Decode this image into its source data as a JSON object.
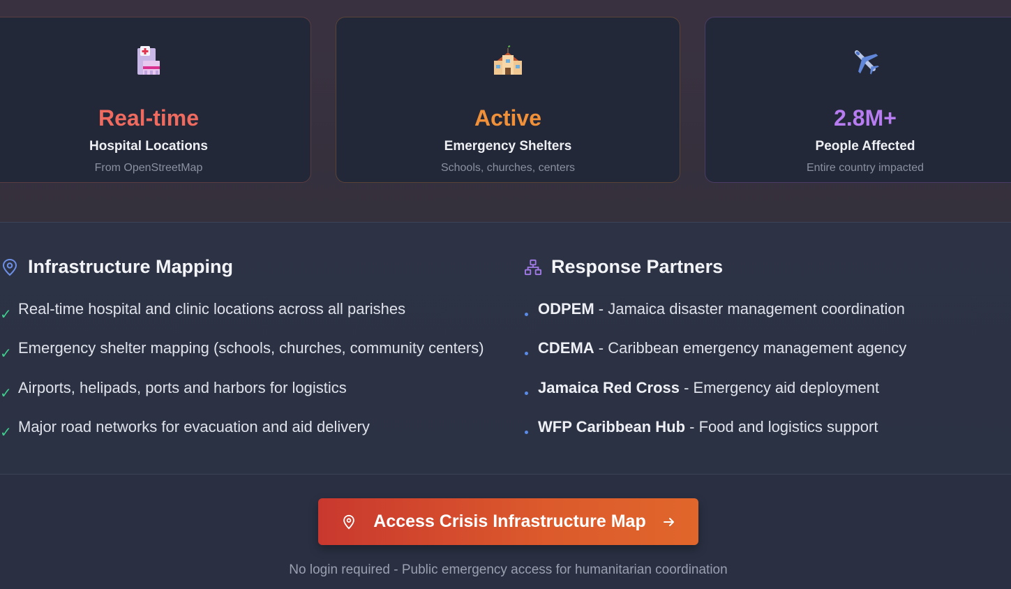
{
  "stats": [
    {
      "icon": "hospital-icon",
      "value": "Real-time",
      "label": "Hospital Locations",
      "sub": "From OpenStreetMap",
      "color": "#ef6a5f"
    },
    {
      "icon": "house-icon",
      "value": "Active",
      "label": "Emergency Shelters",
      "sub": "Schools, churches, centers",
      "color": "#f0913a"
    },
    {
      "icon": "airplane-icon",
      "value": "2.8M+",
      "label": "People Affected",
      "sub": "Entire country impacted",
      "color": "#b77cf0"
    }
  ],
  "infrastructure": {
    "title": "Infrastructure Mapping",
    "items": [
      "Real-time hospital and clinic locations across all parishes",
      "Emergency shelter mapping (schools, churches, community centers)",
      "Airports, helipads, ports and harbors for logistics",
      "Major road networks for evacuation and aid delivery"
    ]
  },
  "partners": {
    "title": "Response Partners",
    "items": [
      {
        "name": "ODPEM",
        "desc": " - Jamaica disaster management coordination"
      },
      {
        "name": "CDEMA",
        "desc": " - Caribbean emergency management agency"
      },
      {
        "name": "Jamaica Red Cross",
        "desc": " - Emergency aid deployment"
      },
      {
        "name": "WFP Caribbean Hub",
        "desc": " - Food and logistics support"
      }
    ]
  },
  "cta": {
    "label": "Access Crisis Infrastructure Map",
    "note": "No login required - Public emergency access for humanitarian coordination"
  },
  "colors": {
    "check": "#3fcf8e",
    "bullet": "#5b8be8",
    "cta_start": "#c9382e",
    "cta_end": "#e0662b"
  }
}
